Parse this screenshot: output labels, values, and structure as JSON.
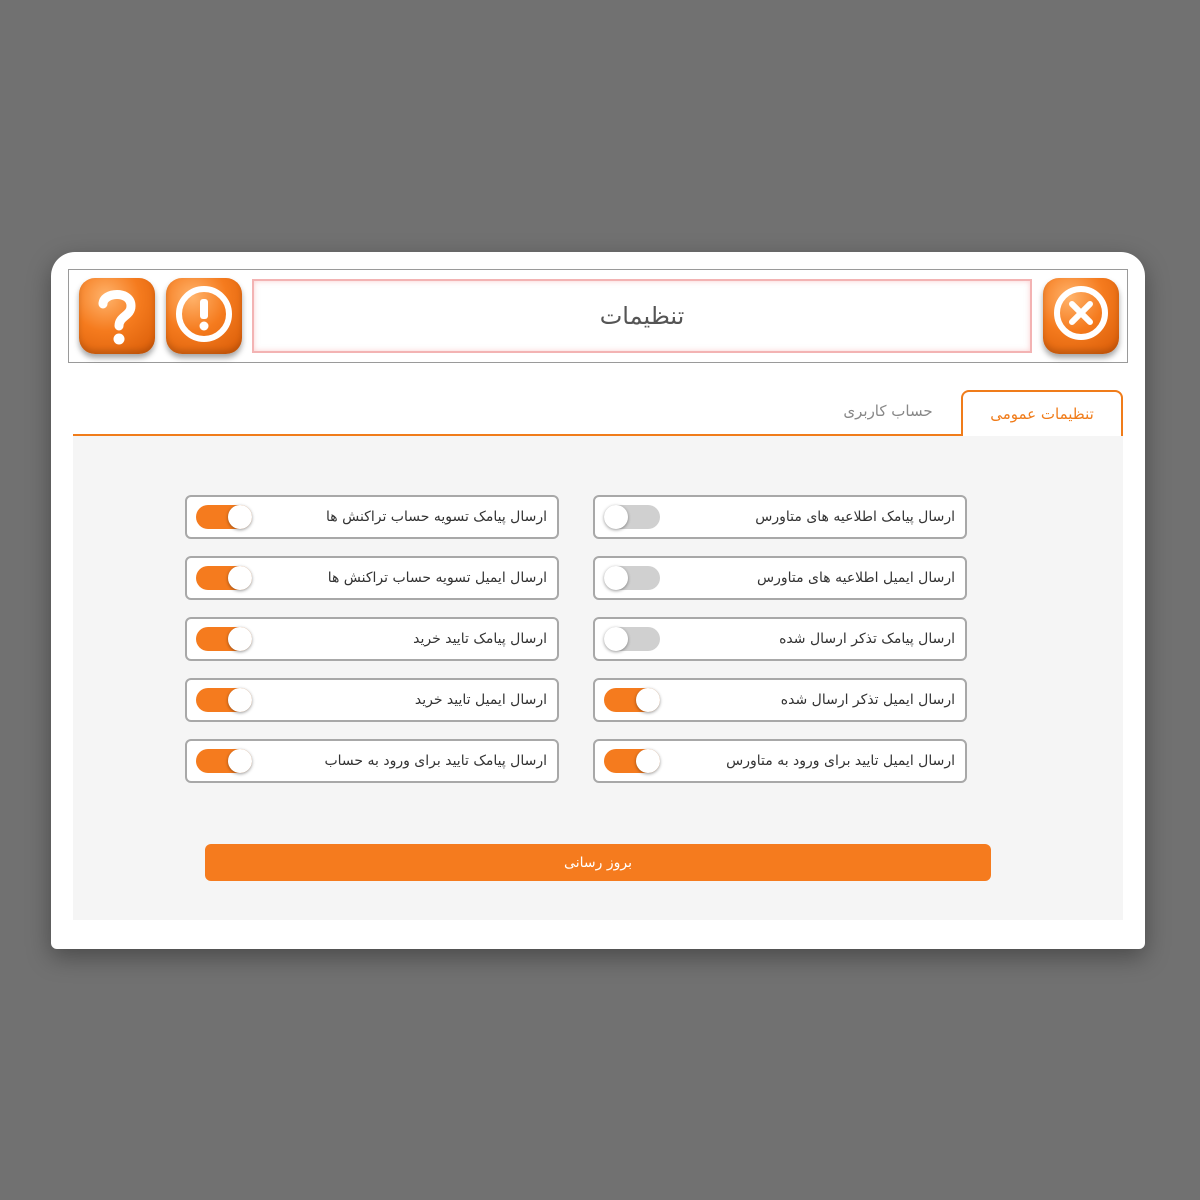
{
  "window": {
    "title": "تنظیمات"
  },
  "icons": {
    "help": "question-icon",
    "alert": "exclamation-icon",
    "close": "close-icon"
  },
  "colors": {
    "accent": "#f57b1e",
    "background": "#717171",
    "panel": "#f5f5f5",
    "toggle_off": "#d0d0d0"
  },
  "tabs": [
    {
      "label": "تنظیمات عمومی",
      "active": true
    },
    {
      "label": "حساب کاربری",
      "active": false
    }
  ],
  "settings": {
    "right": [
      {
        "label": "ارسال پیامک اطلاعیه های متاورس",
        "enabled": false
      },
      {
        "label": "ارسال ایمیل اطلاعیه های متاورس",
        "enabled": false
      },
      {
        "label": "ارسال پیامک تذکر ارسال شده",
        "enabled": false
      },
      {
        "label": "ارسال ایمیل تذکر ارسال شده",
        "enabled": true
      },
      {
        "label": "ارسال ایمیل تایید برای ورود به متاورس",
        "enabled": true
      }
    ],
    "left": [
      {
        "label": "ارسال پیامک تسویه حساب تراکنش ها",
        "enabled": true
      },
      {
        "label": "ارسال ایمیل تسویه حساب تراکنش ها",
        "enabled": true
      },
      {
        "label": "ارسال پیامک تایید خرید",
        "enabled": true
      },
      {
        "label": "ارسال ایمیل تایید خرید",
        "enabled": true
      },
      {
        "label": "ارسال پیامک تایید برای ورود به حساب",
        "enabled": true
      }
    ]
  },
  "update_button": {
    "label": "بروز رسانی"
  }
}
